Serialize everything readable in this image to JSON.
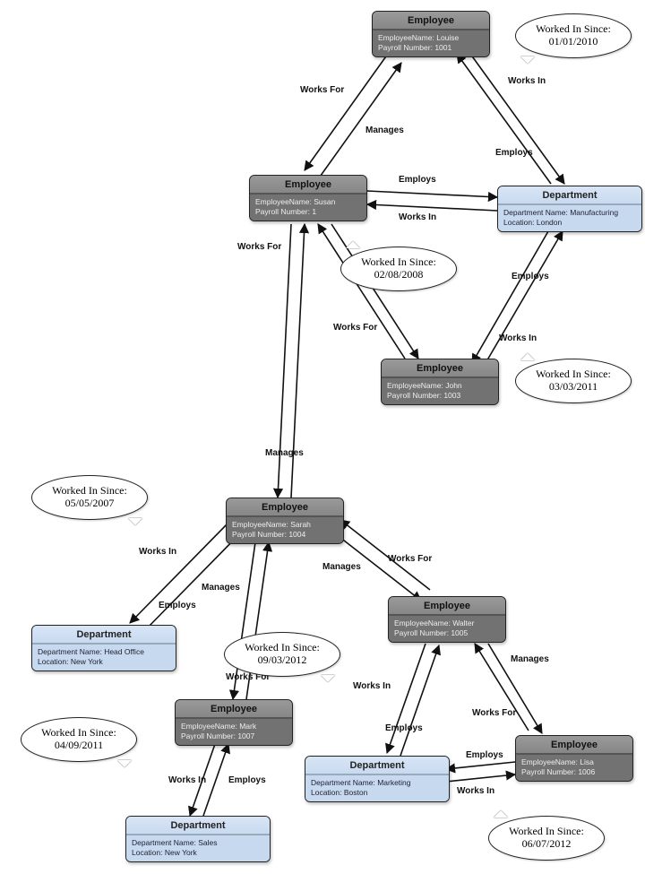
{
  "nodes": {
    "employee_header": "Employee",
    "department_header": "Department",
    "labels": {
      "emp_name": "EmployeeName:",
      "payroll": "Payroll Number:",
      "dep_name": "Department Name:",
      "location": "Location:"
    },
    "emp_louise": {
      "name": "Louise",
      "payroll": "1001"
    },
    "emp_susan": {
      "name": "Susan",
      "payroll": "1"
    },
    "emp_john": {
      "name": "John",
      "payroll": "1003"
    },
    "emp_sarah": {
      "name": "Sarah",
      "payroll": "1004"
    },
    "emp_walter": {
      "name": "Walter",
      "payroll": "1005"
    },
    "emp_lisa": {
      "name": "Lisa",
      "payroll": "1006"
    },
    "emp_mark": {
      "name": "Mark",
      "payroll": "1007"
    },
    "dep_manufacturing": {
      "name": "Manufacturing",
      "location": "London"
    },
    "dep_headoffice": {
      "name": "Head Office",
      "location": "New York"
    },
    "dep_marketing": {
      "name": "Marketing",
      "location": "Boston"
    },
    "dep_sales": {
      "name": "Sales",
      "location": "New York"
    }
  },
  "edge_labels": {
    "works_for": "Works For",
    "works_in": "Works In",
    "manages": "Manages",
    "employs": "Employs"
  },
  "callouts": {
    "label": "Worked In Since:",
    "c_louise": "01/01/2010",
    "c_susan": "02/08/2008",
    "c_john": "03/03/2011",
    "c_sarah": "05/05/2007",
    "c_walter": "09/03/2012",
    "c_mark": "04/09/2011",
    "c_lisa": "06/07/2012"
  }
}
